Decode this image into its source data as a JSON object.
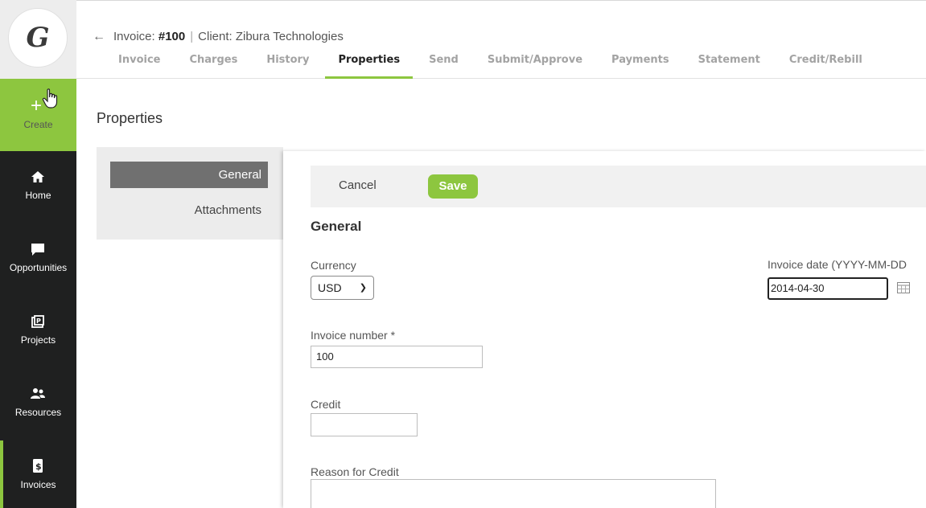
{
  "nav": {
    "logo": "G",
    "create": "Create",
    "items": [
      {
        "label": "Home",
        "icon": "home-icon"
      },
      {
        "label": "Opportunities",
        "icon": "chat-bubble-icon"
      },
      {
        "label": "Projects",
        "icon": "projects-icon"
      },
      {
        "label": "Resources",
        "icon": "people-icon"
      },
      {
        "label": "Invoices",
        "icon": "dollar-document-icon"
      }
    ]
  },
  "header": {
    "back": "←",
    "invoice_prefix": "Invoice: ",
    "invoice_number": "#100",
    "separator": "|",
    "client": "Client: Zibura Technologies",
    "tabs": [
      "Invoice",
      "Charges",
      "History",
      "Properties",
      "Send",
      "Submit/Approve",
      "Payments",
      "Statement",
      "Credit/Rebill"
    ],
    "active_tab": "Properties"
  },
  "page": {
    "title": "Properties"
  },
  "side_menu": {
    "items": [
      "General",
      "Attachments"
    ],
    "active": "General"
  },
  "form": {
    "cancel": "Cancel",
    "save": "Save",
    "section": "General",
    "currency_label": "Currency",
    "currency_value": "USD",
    "invoice_date_label": "Invoice date (YYYY-MM-DD",
    "invoice_date_value": "2014-04-30",
    "invoice_number_label": "Invoice number  *",
    "invoice_number_value": "100",
    "credit_label": "Credit",
    "credit_value": "",
    "reason_label": "Reason for Credit",
    "reason_value": ""
  },
  "colors": {
    "accent": "#8dc63f",
    "nav_bg": "#1f2020",
    "active_menu": "#707070"
  }
}
